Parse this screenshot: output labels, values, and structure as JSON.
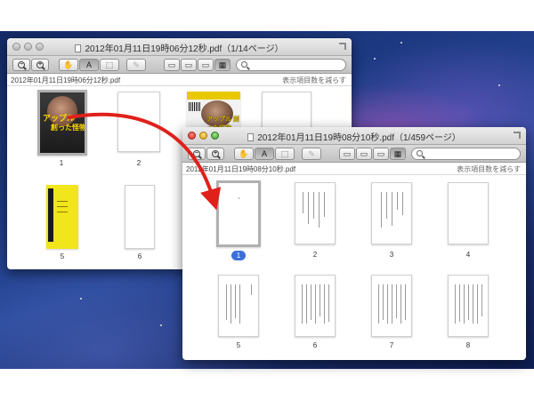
{
  "window1": {
    "title": "2012年01月11日19時06分12秒.pdf（1/14ページ）",
    "path": "2012年01月11日19時06分12秒.pdf",
    "reduce_label": "表示項目数を減らす",
    "toolbar": {
      "zoom_out": "−",
      "zoom_in": "+",
      "text_tool": "A"
    },
    "pages": [
      "1",
      "2",
      "5",
      "6"
    ],
    "cover1_text_a": "アップル",
    "cover1_text_b": "創った怪物",
    "cover3_text": "アップル 創った怪物"
  },
  "window2": {
    "title": "2012年01月11日19時08分10秒.pdf（1/459ページ）",
    "path": "2012年01月11日19時08分10秒.pdf",
    "reduce_label": "表示項目数を減らす",
    "toolbar": {
      "zoom_out": "−",
      "zoom_in": "+",
      "text_tool": "A"
    },
    "pages": [
      "1",
      "2",
      "3",
      "4",
      "5",
      "6",
      "7",
      "8"
    ]
  },
  "colors": {
    "arrow": "#e0201b",
    "selection_badge": "#3e6fd9"
  },
  "icons": [
    "zoom-out-icon",
    "zoom-in-icon",
    "hand-icon",
    "text-select-icon",
    "rect-select-icon",
    "annotate-icon",
    "view-mode-icon",
    "search-icon",
    "resize-icon",
    "pdf-doc-icon"
  ]
}
